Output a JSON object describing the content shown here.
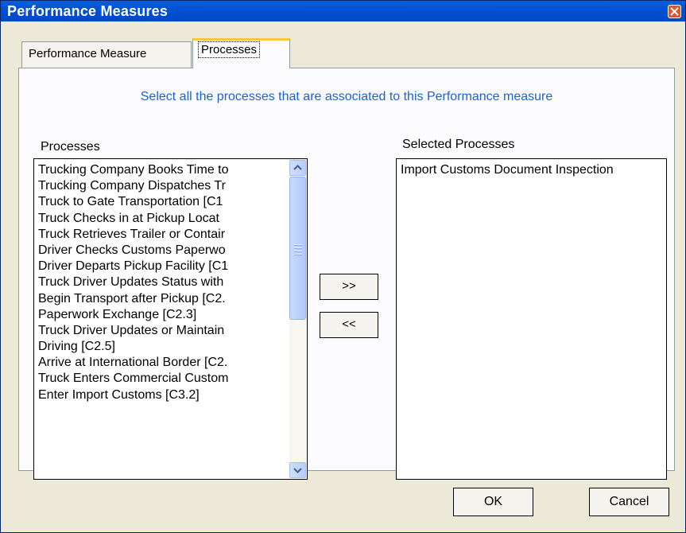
{
  "window": {
    "title": "Performance Measures"
  },
  "tabs": [
    {
      "label": "Performance Measure"
    },
    {
      "label": "Processes"
    }
  ],
  "panel": {
    "instruction": "Select all the processes that are associated to this Performance measure",
    "processes_label": "Processes",
    "selected_label": "Selected Processes",
    "processes": [
      "Trucking Company Books Time to",
      "Trucking Company Dispatches Tr",
      "Truck to Gate Transportation [C1",
      "Truck Checks in at Pickup Locat",
      "Truck Retrieves Trailer or Contair",
      "Driver Checks Customs Paperwo",
      "Driver Departs Pickup Facility [C1",
      "Truck Driver Updates Status with",
      "Begin Transport after Pickup [C2.",
      "Paperwork Exchange [C2.3]",
      "Truck Driver Updates or Maintain",
      "Driving [C2.5]",
      "Arrive at International Border [C2.",
      "Truck Enters Commercial Custom",
      "Enter Import Customs [C3.2]"
    ],
    "selected": [
      "Import Customs Document Inspection"
    ],
    "add_label": ">>",
    "remove_label": "<<"
  },
  "footer": {
    "ok_label": "OK",
    "cancel_label": "Cancel"
  },
  "colors": {
    "titlebar": "#0052d6",
    "instruction": "#1763d6",
    "active_tab_accent": "#ffc83c"
  }
}
